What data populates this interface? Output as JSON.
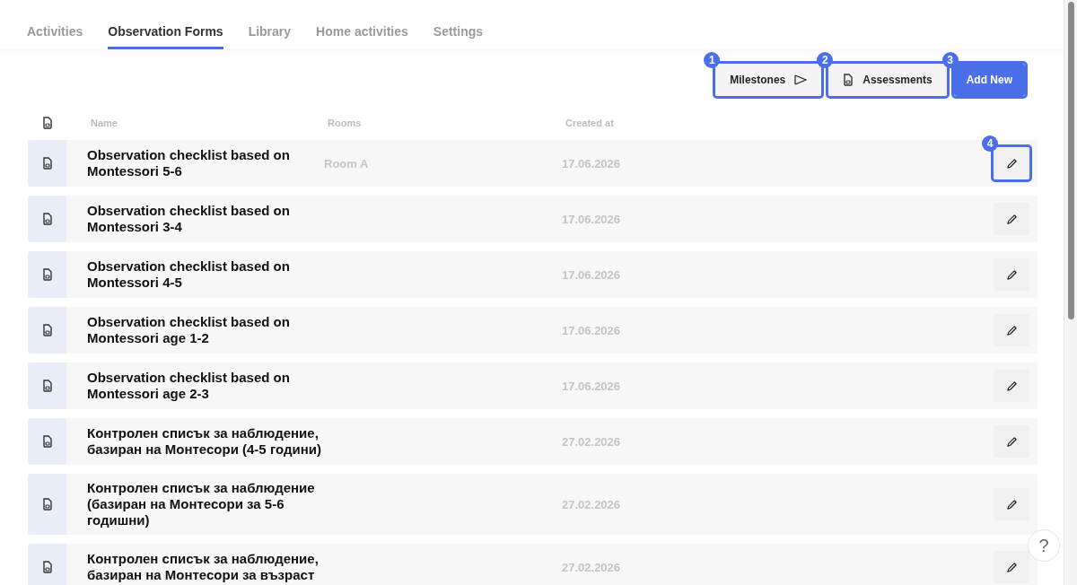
{
  "tabs": [
    {
      "label": "Activities",
      "selected": false
    },
    {
      "label": "Observation Forms",
      "selected": true
    },
    {
      "label": "Library",
      "selected": false
    },
    {
      "label": "Home activities",
      "selected": false
    },
    {
      "label": "Settings",
      "selected": false
    }
  ],
  "actions": [
    {
      "kind": "milestones",
      "label": "Milestones",
      "callout": "1",
      "highlighted": true
    },
    {
      "kind": "assessments",
      "label": "Assessments",
      "callout": "2",
      "highlighted": true
    },
    {
      "kind": "primary",
      "label": "Add New",
      "callout": "3",
      "highlighted": true
    }
  ],
  "table": {
    "columns": [
      "Name",
      "Rooms",
      "Created at"
    ],
    "rows": [
      {
        "name": "Observation checklist based on Montessori 5-6",
        "room": "Room A",
        "created_at": "17.06.2026",
        "edit_highlighted": true,
        "edit_callout": "4"
      },
      {
        "name": "Observation checklist based on Montessori 3-4",
        "created_at": "17.06.2026",
        "edit_highlighted": false
      },
      {
        "name": "Observation checklist based on Montessori 4-5",
        "created_at": "17.06.2026",
        "edit_highlighted": false
      },
      {
        "name": "Observation checklist based on Montessori age 1-2",
        "created_at": "17.06.2026",
        "edit_highlighted": false
      },
      {
        "name": "Observation checklist based on Montessori age 2-3",
        "created_at": "17.06.2026",
        "edit_highlighted": false
      },
      {
        "name": "Контролен списък за наблюдение, базиран на Монтесори (4-5 години)",
        "created_at": "27.02.2026",
        "edit_highlighted": false
      },
      {
        "name": "Контролен списък за наблюдение (базиран на Монтесори за 5-6 годишни)",
        "created_at": "27.02.2026",
        "edit_highlighted": false
      },
      {
        "name": "Контролен списък за наблюдение, базиран на Монтесори за възраст",
        "created_at": "27.02.2026",
        "edit_highlighted": false
      }
    ]
  },
  "help": {
    "label": "?"
  }
}
